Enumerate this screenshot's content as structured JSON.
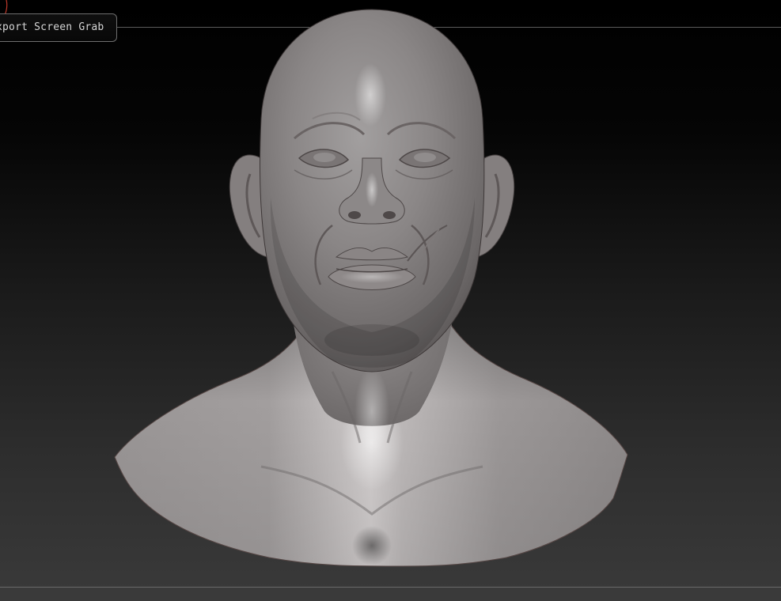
{
  "toolbar": {
    "export_label": "xport Screen Grab"
  },
  "colors": {
    "background_top": "#000000",
    "background_bottom": "#3a3a3a",
    "model_material": "#8a8787",
    "cursor_accent": "#c0392b"
  },
  "icons": {
    "cursor": "brush-cursor-icon"
  }
}
